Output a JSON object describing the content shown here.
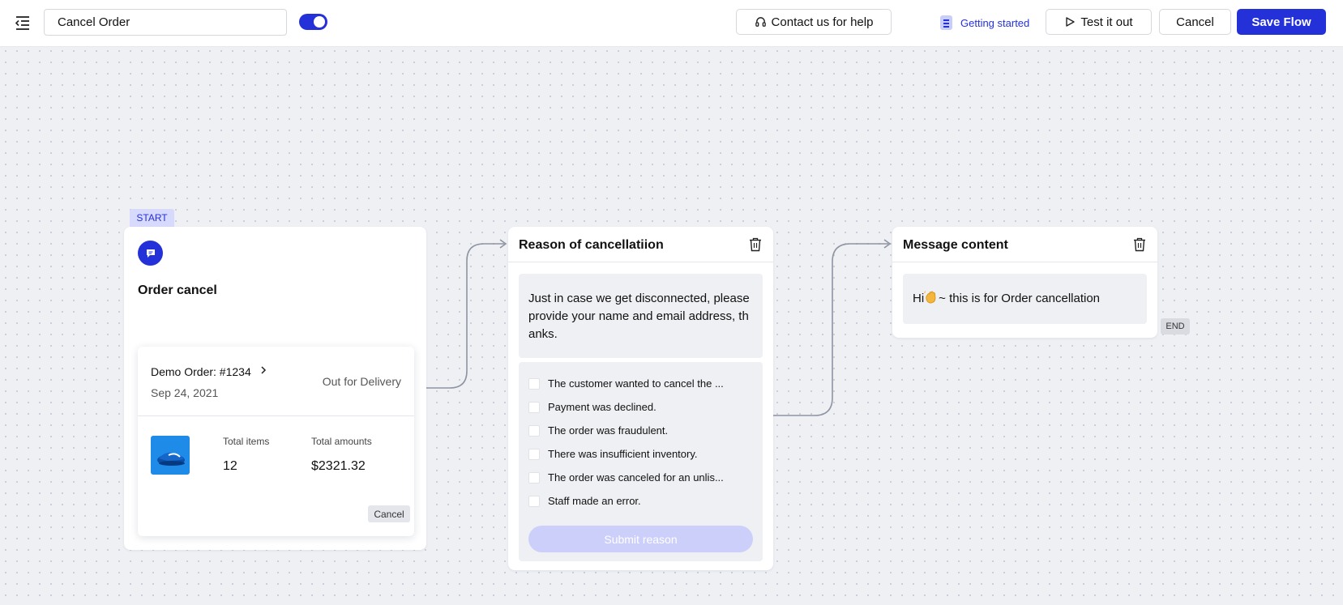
{
  "header": {
    "flow_name": "Cancel Order",
    "toggle_state": "on",
    "contact_label": "Contact us for help",
    "getting_started_label": "Getting started",
    "test_label": "Test it out",
    "cancel_label": "Cancel",
    "save_label": "Save Flow"
  },
  "start_node": {
    "tag": "START",
    "title": "Order cancel",
    "order": {
      "number": "Demo Order: #1234",
      "date": "Sep 24, 2021",
      "status": "Out for Delivery",
      "items_label": "Total items",
      "items_value": "12",
      "amount_label": "Total amounts",
      "amount_value": "$2321.32",
      "cancel_label": "Cancel"
    }
  },
  "reason_node": {
    "title": "Reason of cancellatiion",
    "message": "Just in case we get disconnected, please provide your name and email address, th anks.",
    "options": [
      "The customer wanted to cancel the ...",
      "Payment was declined.",
      "The order was fraudulent.",
      "There was insufficient inventory.",
      "The order was canceled for an unlis...",
      "Staff made an error."
    ],
    "submit_label": "Submit reason"
  },
  "message_node": {
    "title": "Message content",
    "text_before": "Hi",
    "emoji": "waving-hand",
    "text_after": "~ this is for Order cancellation",
    "end_tag": "END"
  },
  "colors": {
    "accent": "#2431d9",
    "accent_light": "#d7dafc",
    "submit_disabled": "#cccffa",
    "canvas": "#eef0f4"
  }
}
